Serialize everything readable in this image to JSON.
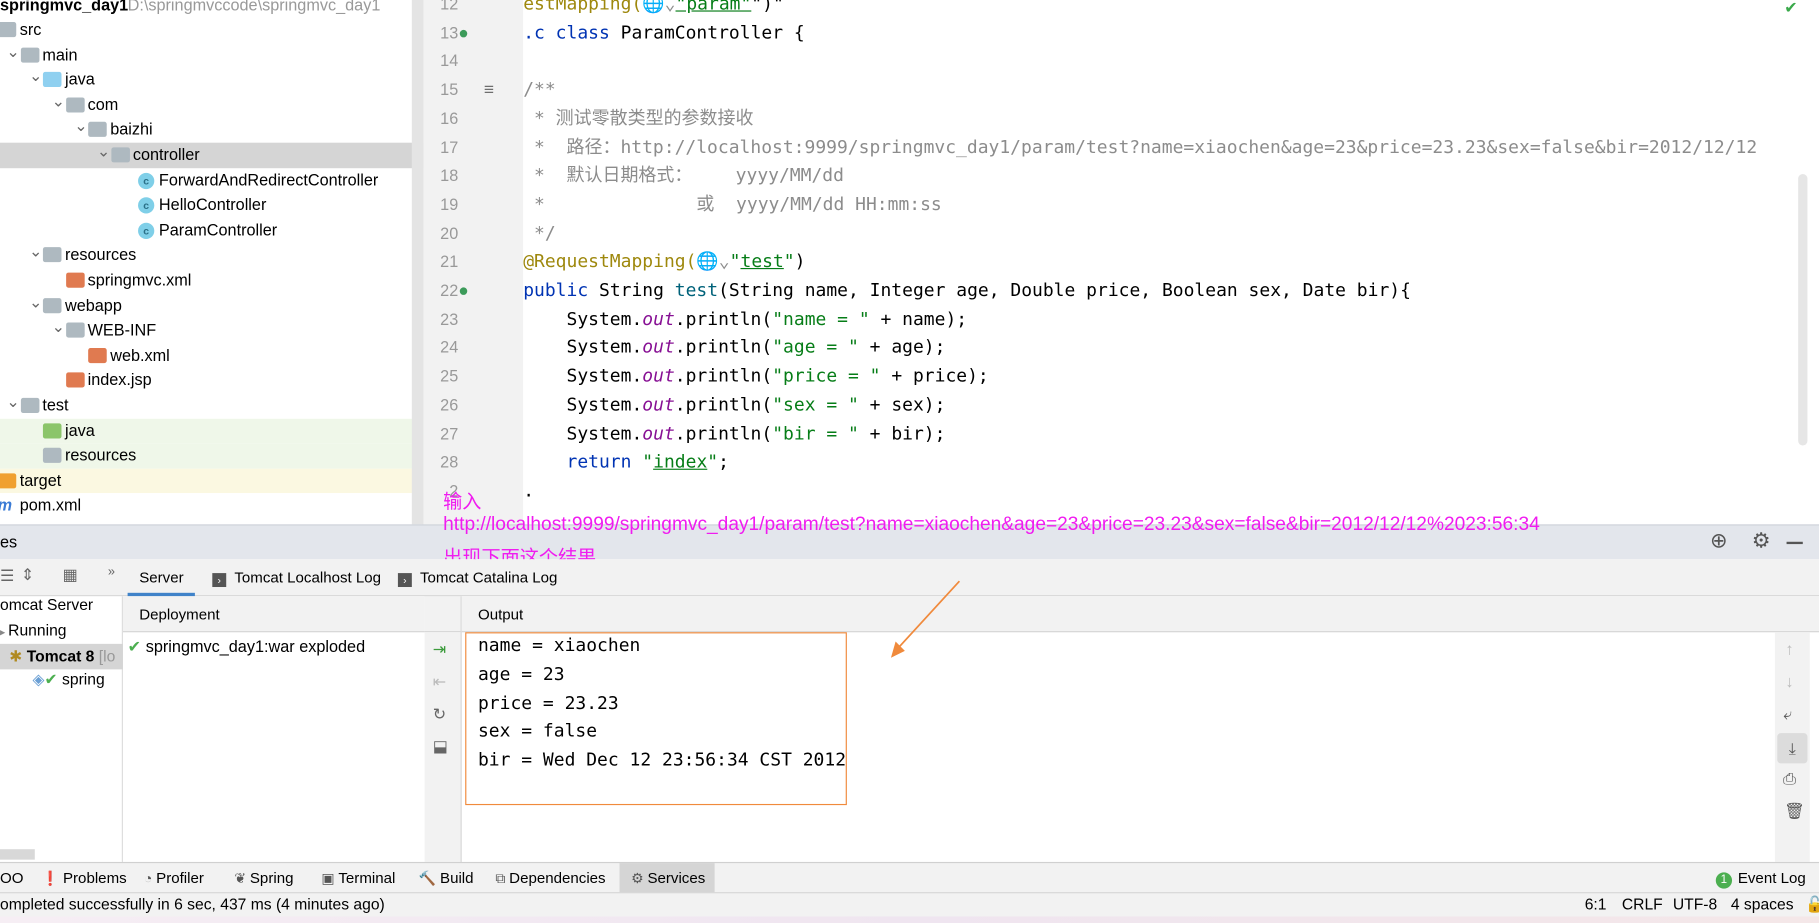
{
  "project": {
    "name": "springmvc_day1",
    "path": "D:\\springmvccode\\springmvc_day1",
    "tree": [
      {
        "label": "src",
        "depth": 0,
        "icon": "folder",
        "expanded": null
      },
      {
        "label": "main",
        "depth": 1,
        "icon": "folder",
        "expanded": true
      },
      {
        "label": "java",
        "depth": 2,
        "icon": "source-folder",
        "expanded": true
      },
      {
        "label": "com",
        "depth": 3,
        "icon": "package",
        "expanded": true
      },
      {
        "label": "baizhi",
        "depth": 4,
        "icon": "package",
        "expanded": true
      },
      {
        "label": "controller",
        "depth": 5,
        "icon": "package",
        "expanded": true,
        "selected": true
      },
      {
        "label": "ForwardAndRedirectController",
        "depth": 6,
        "icon": "class"
      },
      {
        "label": "HelloController",
        "depth": 6,
        "icon": "class"
      },
      {
        "label": "ParamController",
        "depth": 6,
        "icon": "class"
      },
      {
        "label": "resources",
        "depth": 2,
        "icon": "resources-folder",
        "expanded": true
      },
      {
        "label": "springmvc.xml",
        "depth": 3,
        "icon": "xml"
      },
      {
        "label": "webapp",
        "depth": 2,
        "icon": "web-folder",
        "expanded": true
      },
      {
        "label": "WEB-INF",
        "depth": 3,
        "icon": "folder",
        "expanded": true
      },
      {
        "label": "web.xml",
        "depth": 4,
        "icon": "xml"
      },
      {
        "label": "index.jsp",
        "depth": 3,
        "icon": "jsp"
      },
      {
        "label": "test",
        "depth": 1,
        "icon": "folder",
        "expanded": true
      },
      {
        "label": "java",
        "depth": 2,
        "icon": "test-folder",
        "highlight": "green"
      },
      {
        "label": "resources",
        "depth": 2,
        "icon": "resources-folder",
        "highlight": "green"
      },
      {
        "label": "target",
        "depth": 0,
        "icon": "orange-folder",
        "highlight": "yellow"
      },
      {
        "label": "pom.xml",
        "depth": 0,
        "icon": "maven"
      }
    ]
  },
  "editor": {
    "line_numbers": [
      "12",
      "13",
      "14",
      "15",
      "16",
      "17",
      "18",
      "19",
      "20",
      "21",
      "22",
      "23",
      "24",
      "25",
      "26",
      "27",
      "28",
      "2"
    ],
    "lines": [
      [
        [
          "ann",
          "estMapping("
        ],
        [
          "cmt",
          "🌐⌄"
        ],
        [
          "str u",
          "\"param\""
        ],
        [
          "",
          "\")\""
        ]
      ],
      [
        [
          "kw",
          ".c class "
        ],
        [
          "",
          "ParamController {"
        ]
      ],
      [],
      [
        [
          "cmt",
          "/**"
        ]
      ],
      [
        [
          "cmt",
          " * 测试零散类型的参数接收"
        ]
      ],
      [
        [
          "cmt",
          " *  路径：http://localhost:9999/springmvc_day1/param/test?name=xiaochen&age=23&price=23.23&sex=false&bir=2012/12/12"
        ]
      ],
      [
        [
          "cmt",
          " *  默认日期格式：    yyyy/MM/dd"
        ]
      ],
      [
        [
          "cmt",
          " *              或  yyyy/MM/dd HH:mm:ss"
        ]
      ],
      [
        [
          "cmt",
          " */"
        ]
      ],
      [
        [
          "ann",
          "@RequestMapping("
        ],
        [
          "cmt",
          "🌐⌄"
        ],
        [
          "str",
          "\""
        ],
        [
          "str u",
          "test"
        ],
        [
          "str",
          "\""
        ],
        [
          "",
          ")"
        ]
      ],
      [
        [
          "kw",
          "public "
        ],
        [
          "",
          "String "
        ],
        [
          "fn",
          "test"
        ],
        [
          "",
          "(String name, Integer age, Double price, Boolean sex, Date bir){"
        ]
      ],
      [
        [
          "",
          "    System."
        ],
        [
          "fld",
          "out"
        ],
        [
          "",
          ".println("
        ],
        [
          "str",
          "\"name = \""
        ],
        [
          "",
          " + name);"
        ]
      ],
      [
        [
          "",
          "    System."
        ],
        [
          "fld",
          "out"
        ],
        [
          "",
          ".println("
        ],
        [
          "str",
          "\"age = \""
        ],
        [
          "",
          " + age);"
        ]
      ],
      [
        [
          "",
          "    System."
        ],
        [
          "fld",
          "out"
        ],
        [
          "",
          ".println("
        ],
        [
          "str",
          "\"price = \""
        ],
        [
          "",
          " + price);"
        ]
      ],
      [
        [
          "",
          "    System."
        ],
        [
          "fld",
          "out"
        ],
        [
          "",
          ".println("
        ],
        [
          "str",
          "\"sex = \""
        ],
        [
          "",
          " + sex);"
        ]
      ],
      [
        [
          "",
          "    System."
        ],
        [
          "fld",
          "out"
        ],
        [
          "",
          ".println("
        ],
        [
          "str",
          "\"bir = \""
        ],
        [
          "",
          " + bir);"
        ]
      ],
      [
        [
          "kw",
          "    return "
        ],
        [
          "str",
          "\""
        ],
        [
          "str u",
          "index"
        ],
        [
          "str",
          "\""
        ],
        [
          "",
          ";"
        ]
      ],
      [
        [
          "",
          "."
        ]
      ]
    ],
    "current_line": "27",
    "inspection_status": "ok"
  },
  "annotation": {
    "line1": "输入",
    "line2": "http://localhost:9999/springmvc_day1/param/test?name=xiaochen&age=23&price=23.23&sex=false&bir=2012/12/12%2023:56:34",
    "line3": "出现下面这个结果",
    "color": "#f01cf0",
    "box_color": "#f08a3c"
  },
  "services": {
    "title_fragment": "es",
    "tabs": [
      {
        "label": "Server",
        "selected": true
      },
      {
        "label": "Tomcat Localhost Log"
      },
      {
        "label": "Tomcat Catalina Log"
      }
    ],
    "tree": {
      "server": "omcat Server",
      "state": "Running",
      "instance": "Tomcat 8",
      "instance_suffix": "[lo",
      "artifact": "spring"
    },
    "deployment_header": "Deployment",
    "deployment_item": "springmvc_day1:war exploded",
    "output_header": "Output",
    "output_lines": [
      "name = xiaochen",
      "age = 23",
      "price = 23.23",
      "sex = false",
      "bir = Wed Dec 12 23:56:34 CST 2012"
    ]
  },
  "bottom_tabs": [
    {
      "label": "OO",
      "icon": ""
    },
    {
      "label": "Problems",
      "icon": "problems-icon"
    },
    {
      "label": "Profiler",
      "icon": "profiler-icon"
    },
    {
      "label": "Spring",
      "icon": "spring-icon"
    },
    {
      "label": "Terminal",
      "icon": "terminal-icon"
    },
    {
      "label": "Build",
      "icon": "build-icon"
    },
    {
      "label": "Dependencies",
      "icon": "dependencies-icon"
    },
    {
      "label": "Services",
      "icon": "services-icon",
      "selected": true
    }
  ],
  "event_log": {
    "label": "Event Log",
    "count": "1"
  },
  "status": {
    "message": "ompleted successfully in 6 sec, 437 ms (4 minutes ago)",
    "position": "6:1",
    "line_sep": "CRLF",
    "encoding": "UTF-8",
    "indent": "4 spaces"
  }
}
